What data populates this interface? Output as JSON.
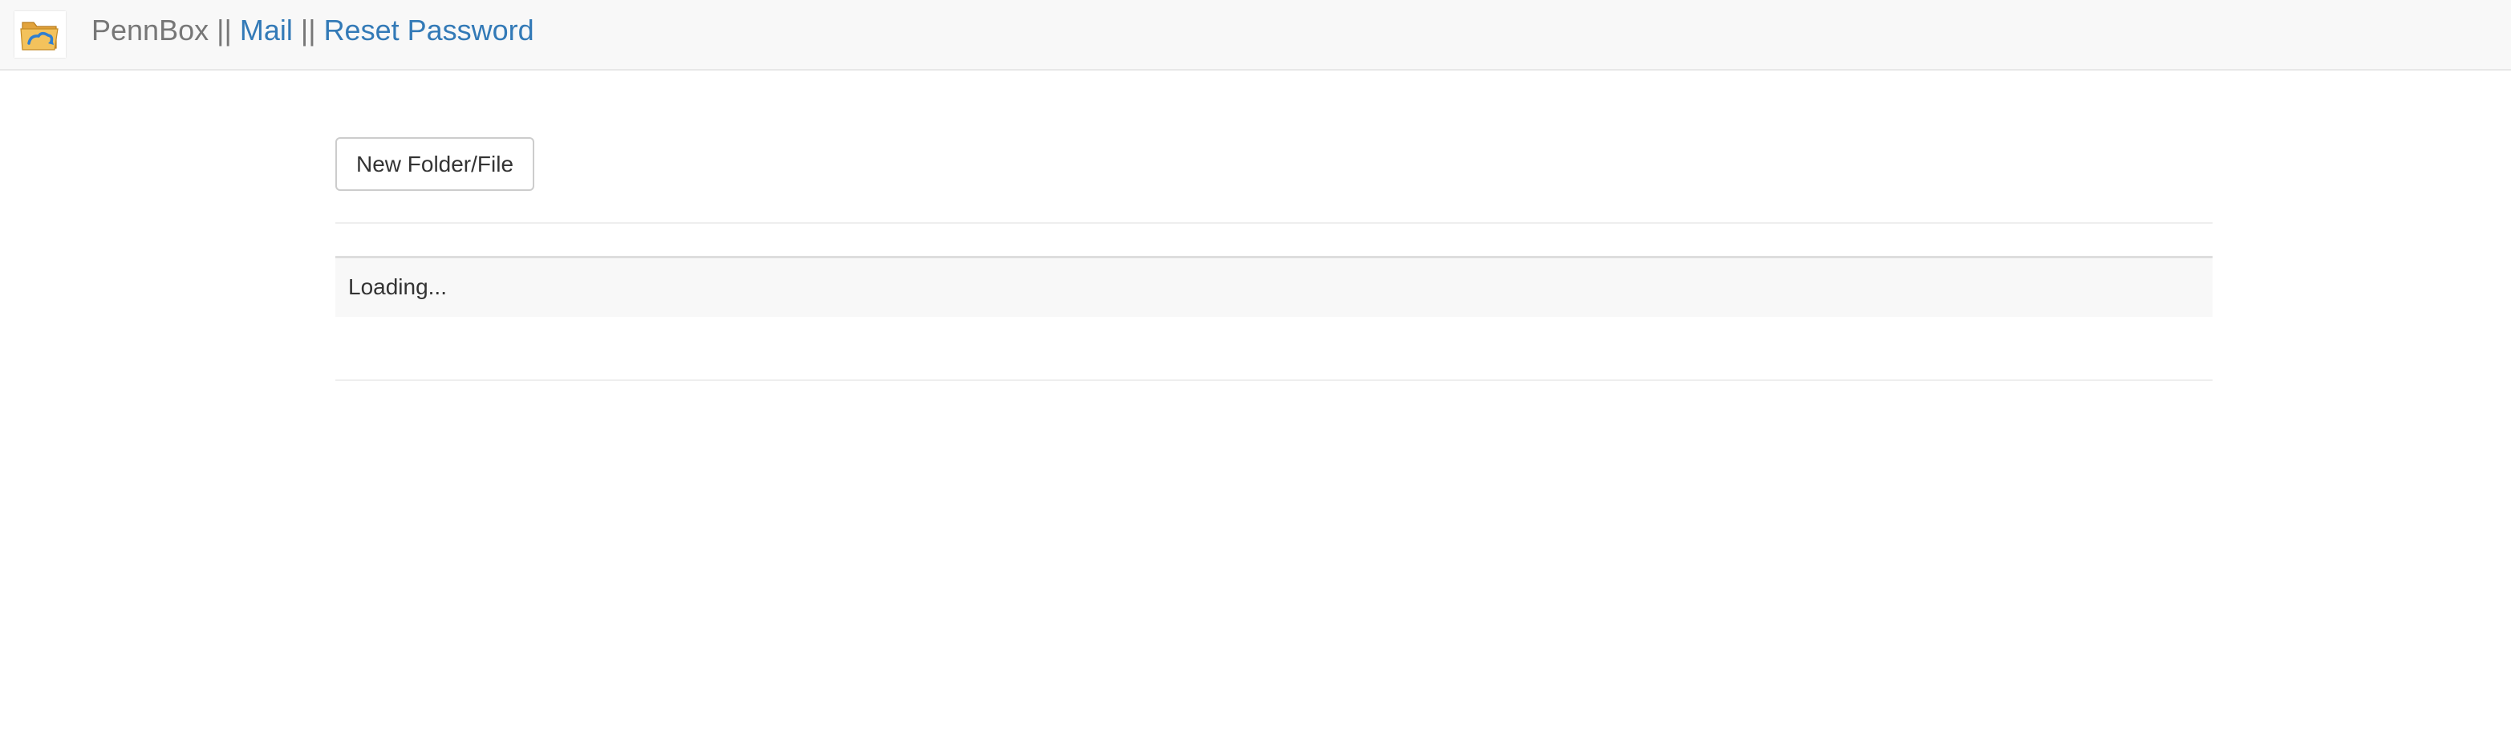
{
  "navbar": {
    "brand": "PennBox",
    "separator1": " || ",
    "mail_link": "Mail",
    "separator2": " || ",
    "reset_link": "Reset Password",
    "logo_icon": "folder-cloud-icon"
  },
  "toolbar": {
    "new_button_label": "New Folder/File"
  },
  "file_list": {
    "loading_text": "Loading..."
  },
  "colors": {
    "link": "#337ab7",
    "navbar_bg": "#f8f8f8",
    "muted_text": "#777777"
  }
}
